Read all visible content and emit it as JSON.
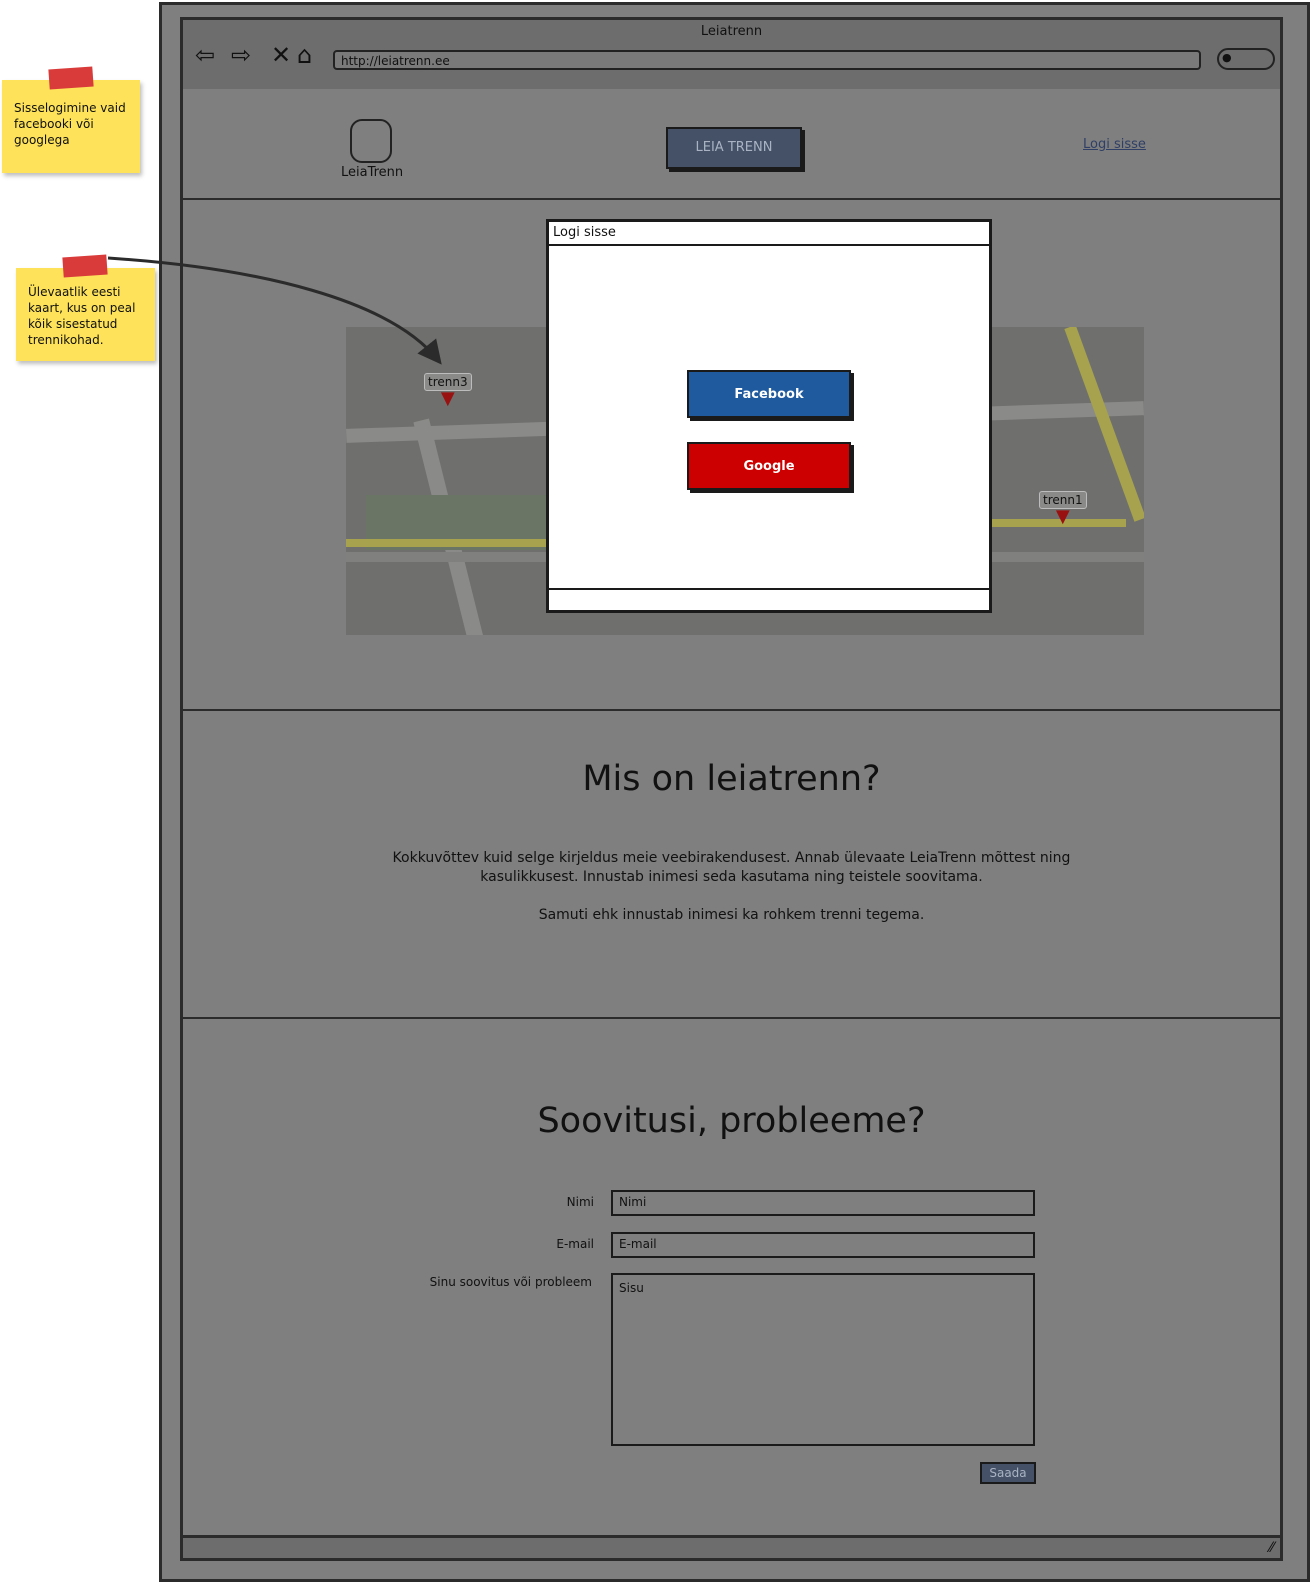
{
  "notes": [
    {
      "text": "Sisselogimine vaid facebooki või googlega"
    },
    {
      "text": "Ülevaatlik eesti kaart, kus on peal kõik sisestatud trennikohad."
    }
  ],
  "browser": {
    "window_title": "Leiatrenn",
    "url": "http://leiatrenn.ee",
    "icons": [
      "back-icon",
      "forward-icon",
      "stop-icon",
      "home-icon",
      "search-icon"
    ]
  },
  "header": {
    "logo_text": "LeiaTrenn",
    "cta_label": "LEIA TRENN",
    "login_link": "Logi sisse"
  },
  "map": {
    "pins": [
      {
        "label": "trenn3"
      },
      {
        "label": "trenn1"
      }
    ]
  },
  "modal": {
    "title": "Logi sisse",
    "facebook_label": "Facebook",
    "google_label": "Google",
    "facebook_color": "#1f5a9e",
    "google_color": "#cc0000"
  },
  "about": {
    "title": "Mis on leiatrenn?",
    "paragraph1_line1": "Kokkuvõttev kuid selge kirjeldus meie veebirakendusest. Annab ülevaate LeiaTrenn mõttest ning",
    "paragraph1_line2": "kasulikkusest. Innustab inimesi seda kasutama ning teistele soovitama.",
    "paragraph2": "Samuti ehk innustab inimesi ka rohkem trenni tegema."
  },
  "feedback": {
    "title": "Soovitusi, probleeme?",
    "name_label": "Nimi",
    "name_placeholder": "Nimi",
    "email_label": "E-mail",
    "email_placeholder": "E-mail",
    "message_label": "Sinu soovitus või probleem",
    "message_placeholder": "Sisu",
    "submit_label": "Saada"
  }
}
